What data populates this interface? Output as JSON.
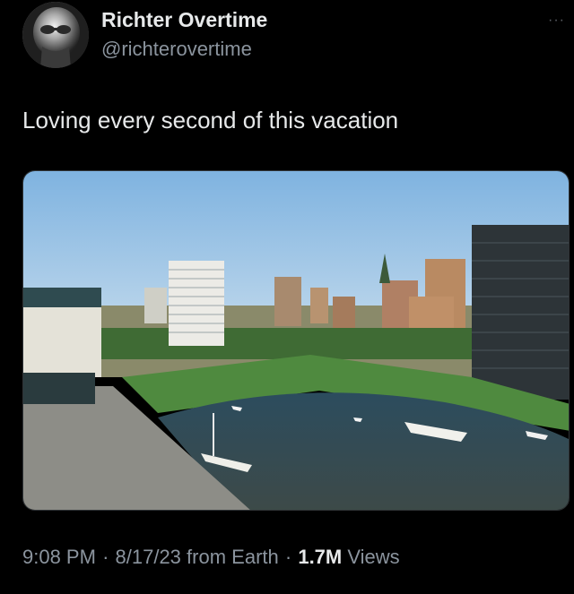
{
  "author": {
    "display_name": "Richter Overtime",
    "handle": "@richterovertime",
    "avatar_icon": "bald-man-avatar"
  },
  "menu": {
    "more_icon": "more-options-icon",
    "more_glyph": "···"
  },
  "tweet": {
    "text": "Loving every second of this vacation"
  },
  "media": {
    "alt": "City waterfront with a harbor, boats, lawn and high-rise buildings"
  },
  "meta": {
    "time": "9:08 PM",
    "separator": "·",
    "date": "8/17/23",
    "source": "from Earth",
    "views_count": "1.7M",
    "views_label": "Views"
  },
  "colors": {
    "background": "#000000",
    "primary_text": "#e7e9ea",
    "secondary_text": "#8b949e"
  }
}
